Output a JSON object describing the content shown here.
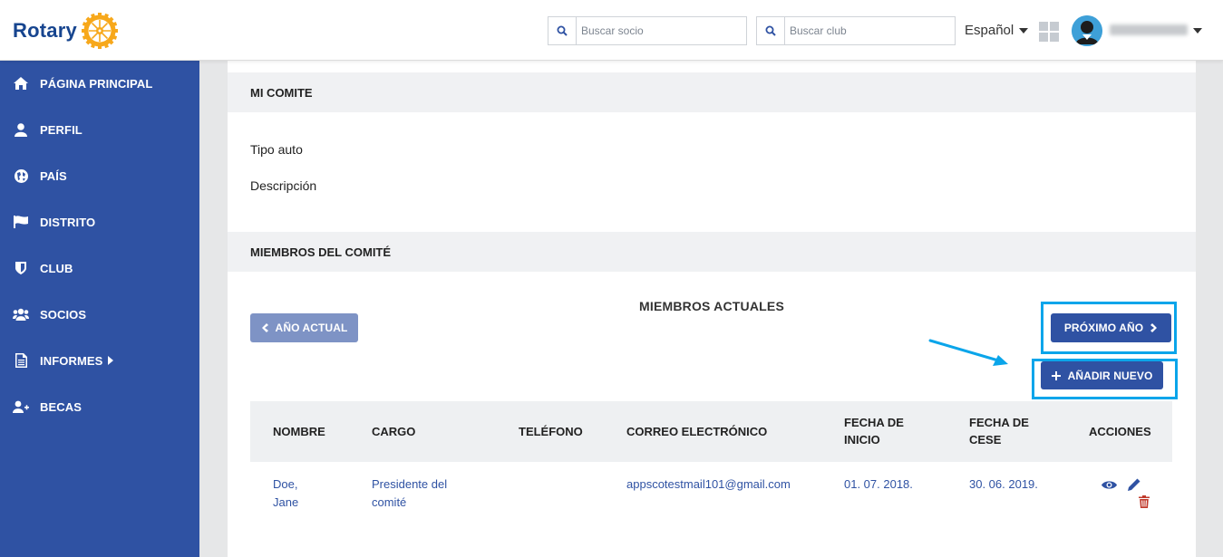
{
  "header": {
    "logo_text": "Rotary",
    "search_member_placeholder": "Buscar socio",
    "search_club_placeholder": "Buscar club",
    "language": "Español"
  },
  "sidebar": {
    "items": [
      {
        "label": "PÁGINA PRINCIPAL",
        "icon": "home-icon"
      },
      {
        "label": "PERFIL",
        "icon": "user-icon"
      },
      {
        "label": "PAÍS",
        "icon": "globe-icon"
      },
      {
        "label": "DISTRITO",
        "icon": "flag-icon"
      },
      {
        "label": "CLUB",
        "icon": "shield-icon"
      },
      {
        "label": "SOCIOS",
        "icon": "users-icon"
      },
      {
        "label": "INFORMES",
        "icon": "document-icon"
      },
      {
        "label": "BECAS",
        "icon": "user-plus-icon"
      }
    ]
  },
  "committee": {
    "section_title": "MI COMITE",
    "type_label": "Tipo auto",
    "description_label": "Descripción"
  },
  "members": {
    "section_title": "MIEMBROS DEL COMITÉ",
    "current_title": "MIEMBROS ACTUALES",
    "prev_year_label": "AÑO ACTUAL",
    "next_year_label": "PRÓXIMO AÑO",
    "add_new_label": "AÑADIR NUEVO",
    "columns": {
      "name": "NOMBRE",
      "role": "CARGO",
      "phone": "TELÉFONO",
      "email": "CORREO ELECTRÓNICO",
      "start_1": "FECHA DE",
      "start_2": "INICIO",
      "end_1": "FECHA DE",
      "end_2": "CESE",
      "actions": "ACCIONES"
    },
    "rows": [
      {
        "name_1": "Doe,",
        "name_2": "Jane",
        "role_1": "Presidente del",
        "role_2": "comité",
        "phone": "",
        "email": "appscotestmail101@gmail.com",
        "start": "01. 07. 2018.",
        "end": "30. 06. 2019."
      }
    ]
  },
  "colors": {
    "brand_blue": "#2f52a3",
    "highlight": "#0aa5ea",
    "delete_red": "#c0392b"
  }
}
